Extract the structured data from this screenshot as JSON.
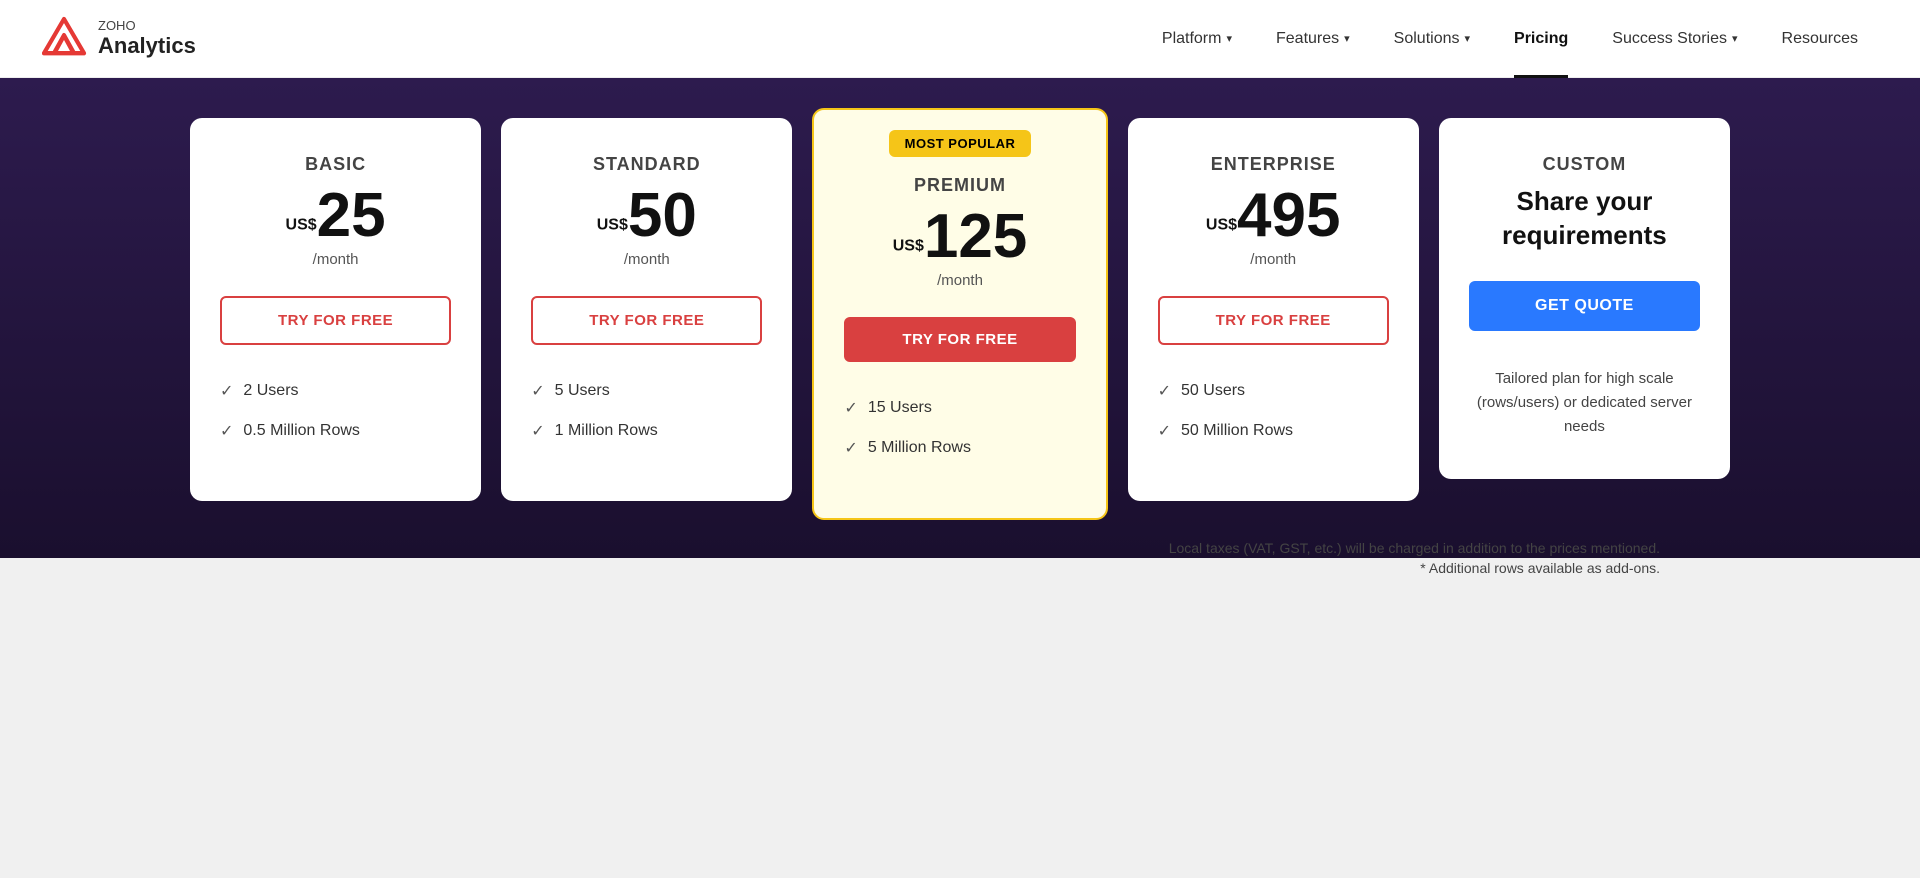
{
  "navbar": {
    "logo": {
      "zoho": "ZOHO",
      "analytics": "Analytics"
    },
    "links": [
      {
        "id": "platform",
        "label": "Platform",
        "hasArrow": true,
        "active": false
      },
      {
        "id": "features",
        "label": "Features",
        "hasArrow": true,
        "active": false
      },
      {
        "id": "solutions",
        "label": "Solutions",
        "hasArrow": true,
        "active": false
      },
      {
        "id": "pricing",
        "label": "Pricing",
        "hasArrow": false,
        "active": true
      },
      {
        "id": "success-stories",
        "label": "Success Stories",
        "hasArrow": true,
        "active": false
      },
      {
        "id": "resources",
        "label": "Resources",
        "hasArrow": false,
        "active": false
      }
    ]
  },
  "plans": [
    {
      "id": "basic",
      "name": "BASIC",
      "currency": "US$",
      "price": "25",
      "period": "/month",
      "cta": "TRY FOR FREE",
      "ctaType": "outline",
      "badge": null,
      "features": [
        "2 Users",
        "0.5 Million Rows"
      ],
      "isPremium": false,
      "isCustom": false
    },
    {
      "id": "standard",
      "name": "STANDARD",
      "currency": "US$",
      "price": "50",
      "period": "/month",
      "cta": "TRY FOR FREE",
      "ctaType": "outline",
      "badge": null,
      "features": [
        "5 Users",
        "1 Million Rows"
      ],
      "isPremium": false,
      "isCustom": false
    },
    {
      "id": "premium",
      "name": "PREMIUM",
      "currency": "US$",
      "price": "125",
      "period": "/month",
      "cta": "TRY FOR FREE",
      "ctaType": "filled",
      "badge": "MOST POPULAR",
      "features": [
        "15 Users",
        "5 Million Rows"
      ],
      "isPremium": true,
      "isCustom": false
    },
    {
      "id": "enterprise",
      "name": "ENTERPRISE",
      "currency": "US$",
      "price": "495",
      "period": "/month",
      "cta": "TRY FOR FREE",
      "ctaType": "outline",
      "badge": null,
      "features": [
        "50 Users",
        "50 Million Rows"
      ],
      "isPremium": false,
      "isCustom": false
    },
    {
      "id": "custom",
      "name": "CUSTOM",
      "shareText": "Share your requirements",
      "cta": "GET QUOTE",
      "ctaType": "blue",
      "badge": null,
      "features": [],
      "desc": "Tailored plan for high scale (rows/users) or dedicated server needs",
      "isPremium": false,
      "isCustom": true
    }
  ],
  "footer": {
    "tax_note": "Local taxes (VAT, GST, etc.) will be charged in addition to the prices mentioned.",
    "addon_note": "* Additional rows available as add-ons."
  }
}
